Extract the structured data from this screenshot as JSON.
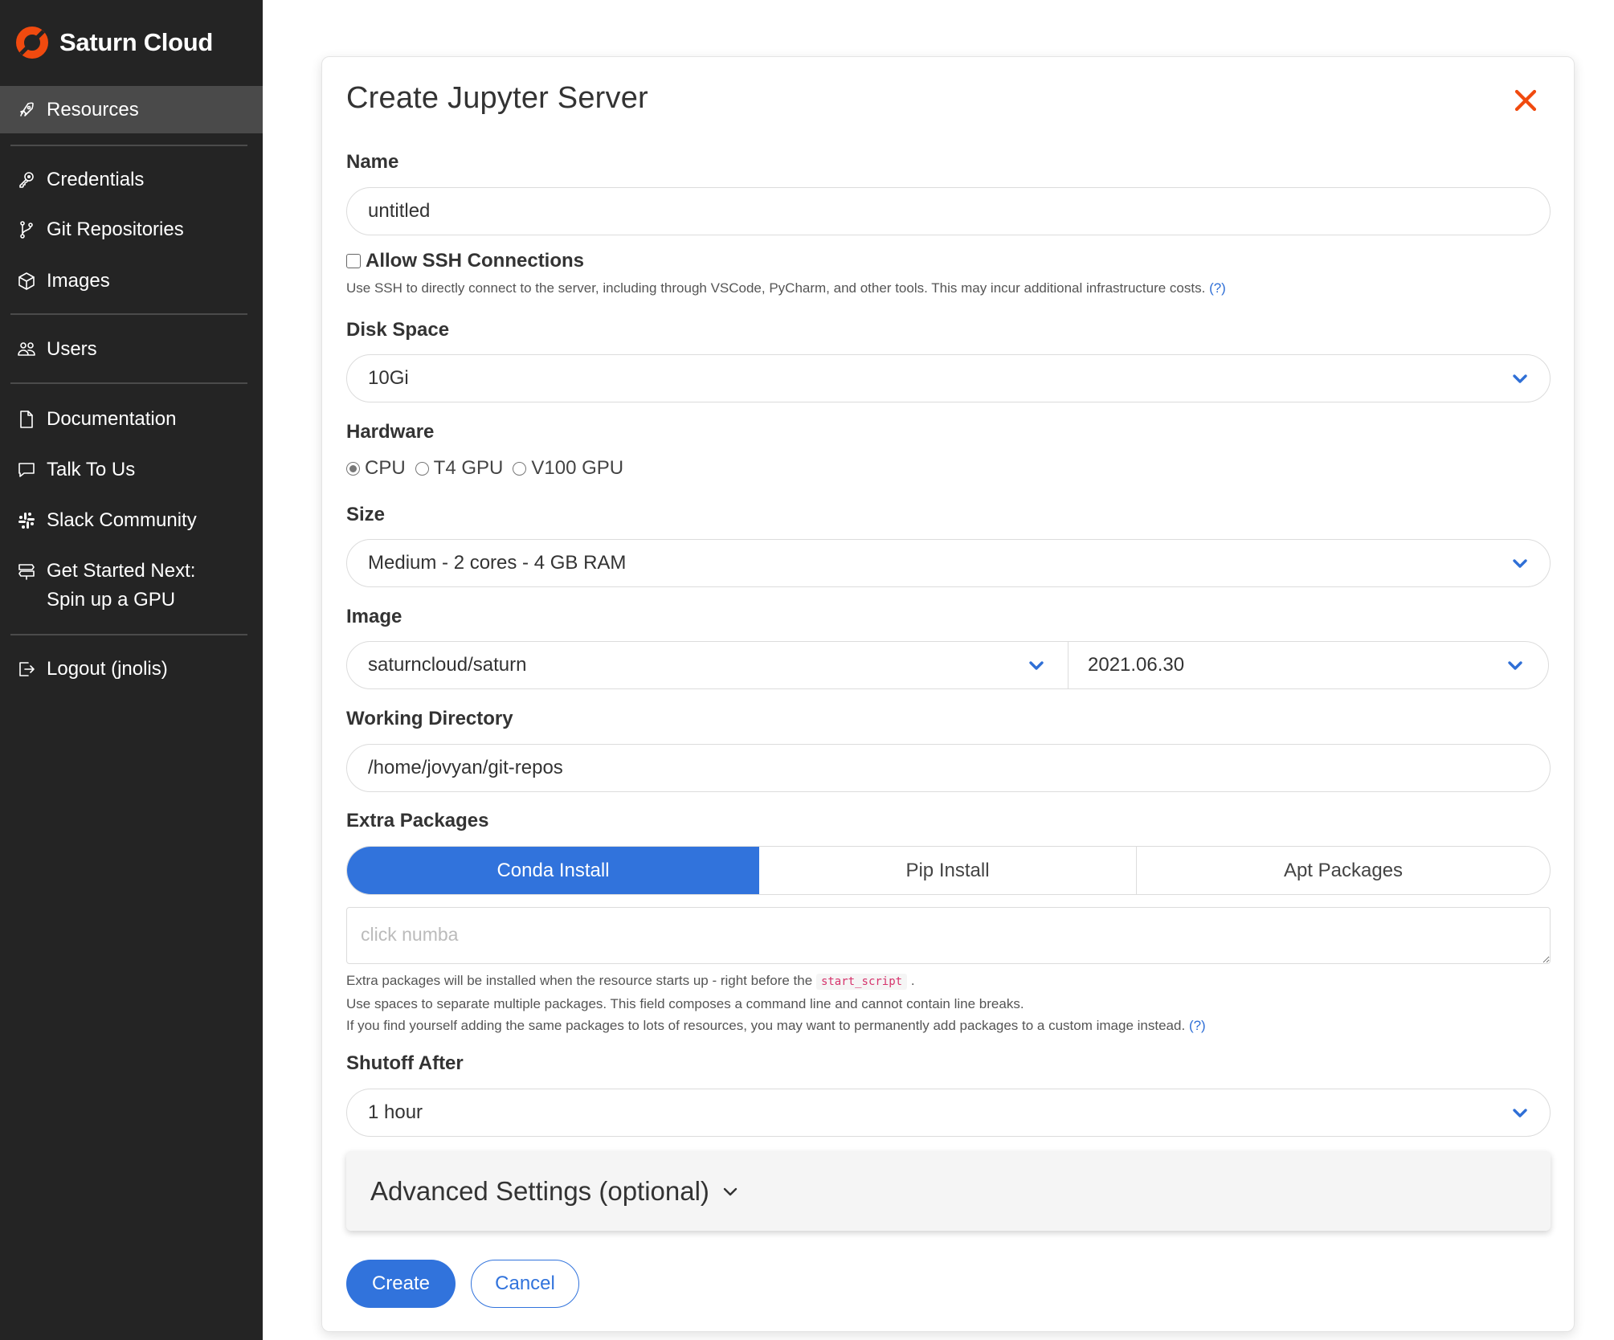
{
  "brand": {
    "name": "Saturn Cloud",
    "logo_color": "#f04a0f"
  },
  "sidebar": {
    "items": [
      {
        "label": "Resources",
        "icon": "rocket-icon",
        "active": true
      },
      {
        "label": "Credentials",
        "icon": "key-icon"
      },
      {
        "label": "Git Repositories",
        "icon": "git-branch-icon"
      },
      {
        "label": "Images",
        "icon": "cube-icon"
      },
      {
        "label": "Users",
        "icon": "users-icon"
      },
      {
        "label": "Documentation",
        "icon": "document-icon"
      },
      {
        "label": "Talk To Us",
        "icon": "chat-icon"
      },
      {
        "label": "Slack Community",
        "icon": "slack-icon"
      },
      {
        "label_line1": "Get Started Next:",
        "label_line2": "Spin up a GPU",
        "icon": "signpost-icon"
      },
      {
        "label": "Logout (jnolis)",
        "icon": "logout-icon"
      }
    ]
  },
  "modal": {
    "title": "Create Jupyter Server",
    "close_icon": "close-icon",
    "accent_color": "#3173dc",
    "name": {
      "label": "Name",
      "value": "untitled"
    },
    "ssh": {
      "label": "Allow SSH Connections",
      "checked": false,
      "help": "Use SSH to directly connect to the server, including through VSCode, PyCharm, and other tools. This may incur additional infrastructure costs.",
      "help_link": "(?)"
    },
    "disk_space": {
      "label": "Disk Space",
      "value": "10Gi"
    },
    "hardware": {
      "label": "Hardware",
      "options": [
        "CPU",
        "T4 GPU",
        "V100 GPU"
      ],
      "selected": "CPU"
    },
    "size": {
      "label": "Size",
      "value": "Medium - 2 cores - 4 GB RAM"
    },
    "image": {
      "label": "Image",
      "name_value": "saturncloud/saturn",
      "version_value": "2021.06.30"
    },
    "working_directory": {
      "label": "Working Directory",
      "value": "/home/jovyan/git-repos"
    },
    "extra_packages": {
      "label": "Extra Packages",
      "tabs": [
        "Conda Install",
        "Pip Install",
        "Apt Packages"
      ],
      "active_tab": "Conda Install",
      "placeholder": "click numba",
      "help_line1_pre": "Extra packages will be installed when the resource starts up - right before the",
      "help_line1_code": "start_script",
      "help_line1_post": ".",
      "help_line2": "Use spaces to separate multiple packages. This field composes a command line and cannot contain line breaks.",
      "help_line3": "If you find yourself adding the same packages to lots of resources, you may want to permanently add packages to a custom image instead.",
      "help_link": "(?)"
    },
    "shutoff": {
      "label": "Shutoff After",
      "value": "1 hour"
    },
    "advanced": {
      "label": "Advanced Settings (optional)"
    },
    "buttons": {
      "create": "Create",
      "cancel": "Cancel"
    }
  }
}
